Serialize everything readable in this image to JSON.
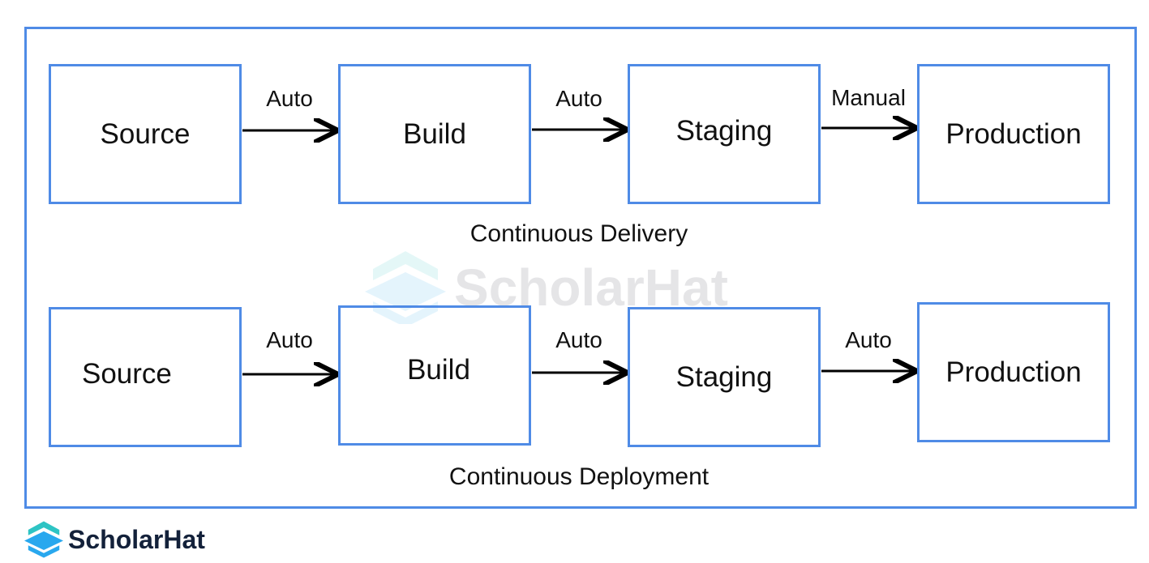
{
  "colors": {
    "box_border": "#4f8be6",
    "arrow": "#000000",
    "logo_teal": "#2ec4c4",
    "logo_blue": "#29a8ee"
  },
  "rows": [
    {
      "caption": "Continuous Delivery",
      "stages": [
        "Source",
        "Build",
        "Staging",
        "Production"
      ],
      "transitions": [
        "Auto",
        "Auto",
        "Manual"
      ]
    },
    {
      "caption": "Continuous Deployment",
      "stages": [
        "Source",
        "Build",
        "Staging",
        "Production"
      ],
      "transitions": [
        "Auto",
        "Auto",
        "Auto"
      ]
    }
  ],
  "watermark": "ScholarHat",
  "logo": {
    "text": "ScholarHat",
    "icon": "graduation-hat-stack-icon"
  }
}
